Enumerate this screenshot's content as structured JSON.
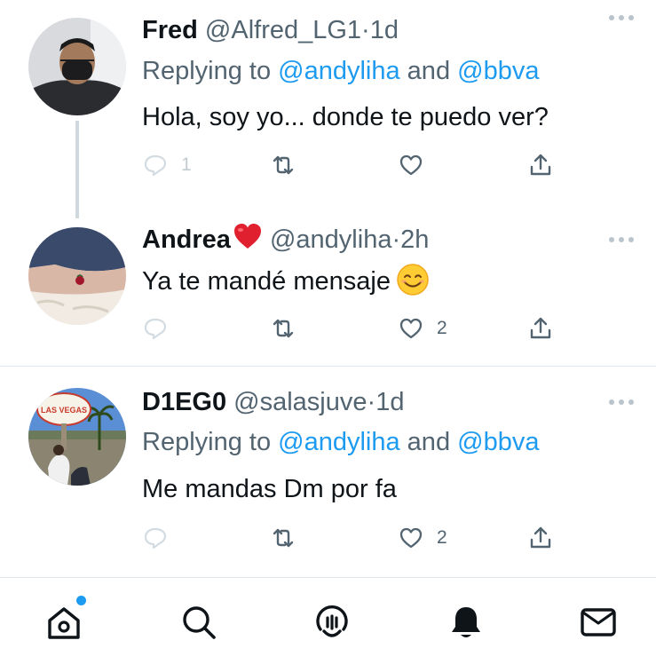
{
  "tweets": [
    {
      "name": "Fred",
      "handle": "@Alfred_LG1",
      "time": "1d",
      "replying_prefix": "Replying to ",
      "mention1": "@andyliha",
      "conjunction": " and ",
      "mention2": "@bbva",
      "text": "Hola, soy yo... donde te puedo ver?",
      "reply_count": "1",
      "like_count": ""
    },
    {
      "name": "Andrea",
      "handle": "@andyliha",
      "time": "2h",
      "text": "Ya te mandé mensaje",
      "reply_count": "",
      "like_count": "2"
    },
    {
      "name": "D1EG0",
      "handle": "@salasjuve",
      "time": "1d",
      "replying_prefix": "Replying to ",
      "mention1": "@andyliha",
      "conjunction": " and ",
      "mention2": "@bbva",
      "text": "Me mandas Dm por fa",
      "reply_count": "",
      "like_count": "2",
      "avatar_sign_text": "LAS VEGAS"
    }
  ],
  "tabbar": {
    "items": [
      "home-icon",
      "search-icon",
      "spaces-icon",
      "notifications-icon",
      "messages-icon"
    ],
    "home_has_dot": true
  },
  "colors": {
    "accent": "#1d9bf0",
    "secondary_text": "#536471",
    "primary_text": "#0f1419"
  }
}
